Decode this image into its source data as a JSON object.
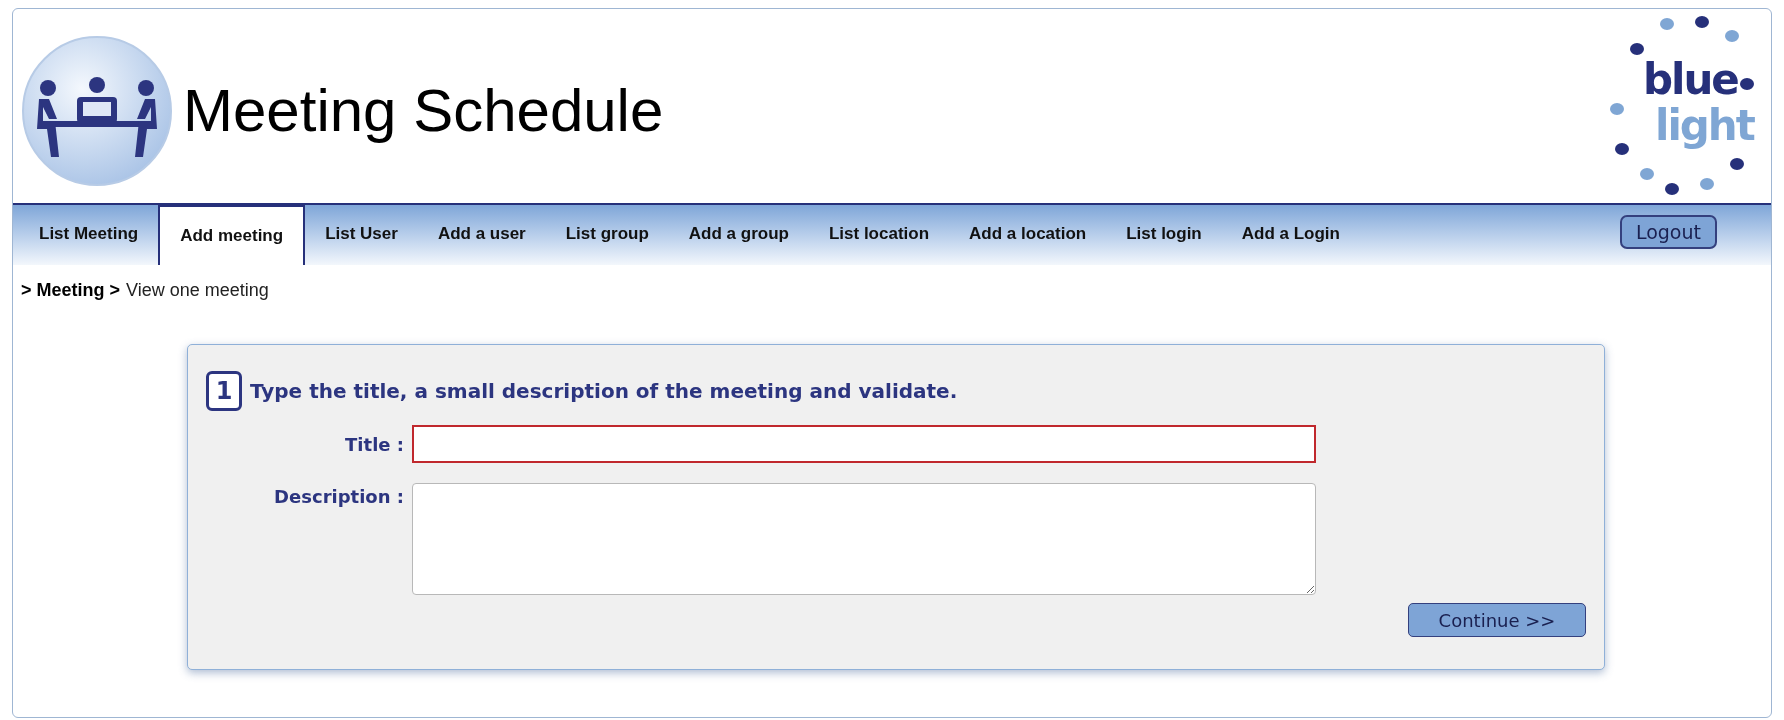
{
  "header": {
    "title": "Meeting Schedule",
    "logo": {
      "word_1": "blue",
      "word_2": "light"
    }
  },
  "nav": {
    "tabs": [
      {
        "label": "List Meeting",
        "selected": false
      },
      {
        "label": "Add meeting",
        "selected": true
      },
      {
        "label": "List User",
        "selected": false
      },
      {
        "label": "Add a user",
        "selected": false
      },
      {
        "label": "List group",
        "selected": false
      },
      {
        "label": "Add a group",
        "selected": false
      },
      {
        "label": "List location",
        "selected": false
      },
      {
        "label": "Add a location",
        "selected": false
      },
      {
        "label": "List login",
        "selected": false
      },
      {
        "label": "Add a Login",
        "selected": false
      }
    ],
    "logout": "Logout"
  },
  "breadcrumb": {
    "section": "> Meeting >",
    "page": "View one meeting"
  },
  "form": {
    "step": "1",
    "instruction": "Type the title, a small description of the meeting and validate.",
    "fields": [
      {
        "label": "Title :",
        "kind": "input",
        "invalid": true
      },
      {
        "label": "Description :",
        "kind": "textarea",
        "invalid": false
      }
    ],
    "submit": "Continue >>"
  }
}
